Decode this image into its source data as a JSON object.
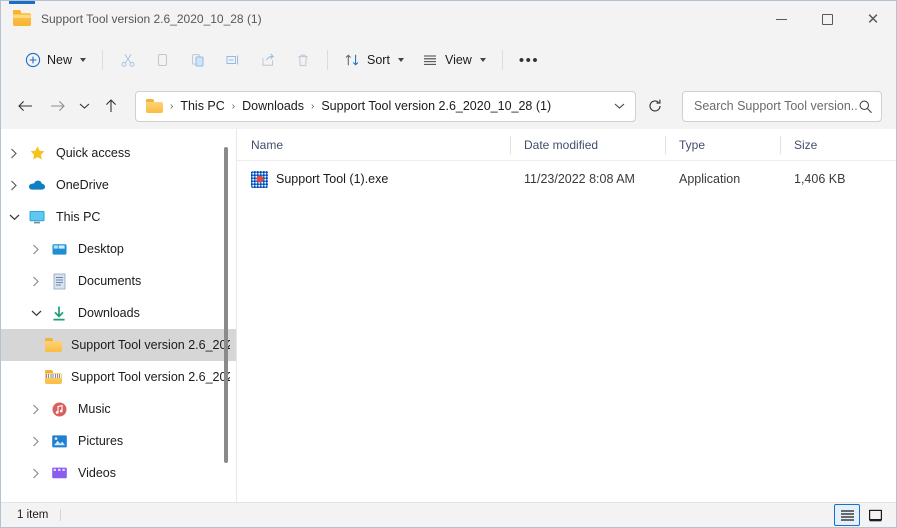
{
  "window": {
    "title": "Support Tool version 2.6_2020_10_28 (1)",
    "folder_icon": "folder-icon",
    "controls": {
      "minimize": "—",
      "maximize": "□",
      "close": "✕"
    }
  },
  "toolbar": {
    "new_label": "New",
    "new_icon": "plus-circle-icon",
    "cut_icon": "scissors-icon",
    "copy_icon": "copy-icon",
    "paste_icon": "clipboard-icon",
    "rename_icon": "rename-icon",
    "share_icon": "share-icon",
    "delete_icon": "trash-icon",
    "sort_label": "Sort",
    "sort_icon": "sort-arrows-icon",
    "view_label": "View",
    "view_icon": "list-lines-icon",
    "more_label": "•••",
    "more_icon": "more-ellipsis-icon"
  },
  "address": {
    "back_icon": "arrow-left-icon",
    "forward_icon": "arrow-right-icon",
    "recent_icon": "chevron-down-icon",
    "up_icon": "arrow-up-icon",
    "crumbs": [
      "This PC",
      "Downloads",
      "Support Tool version 2.6_2020_10_28 (1)"
    ],
    "separator": "›",
    "dropdown_icon": "chevron-down-icon",
    "refresh_icon": "refresh-icon"
  },
  "search": {
    "placeholder": "Search Support Tool version...",
    "icon": "search-icon",
    "value": ""
  },
  "sidebar": {
    "items": [
      {
        "label": "Quick access",
        "icon": "star-icon",
        "indent": 1,
        "expander": "collapsed",
        "selected": false
      },
      {
        "label": "OneDrive",
        "icon": "cloud-icon",
        "indent": 1,
        "expander": "collapsed",
        "selected": false
      },
      {
        "label": "This PC",
        "icon": "monitor-icon",
        "indent": 1,
        "expander": "expanded",
        "selected": false
      },
      {
        "label": "Desktop",
        "icon": "desktop-icon",
        "indent": 2,
        "expander": "collapsed",
        "selected": false
      },
      {
        "label": "Documents",
        "icon": "document-icon",
        "indent": 2,
        "expander": "collapsed",
        "selected": false
      },
      {
        "label": "Downloads",
        "icon": "download-arrow-icon",
        "indent": 2,
        "expander": "expanded",
        "selected": false
      },
      {
        "label": "Support Tool version 2.6_202",
        "icon": "folder-icon",
        "indent": 3,
        "expander": "none",
        "selected": true
      },
      {
        "label": "Support Tool version 2.6_202",
        "icon": "zipped-folder-icon",
        "indent": 3,
        "expander": "none",
        "selected": false
      },
      {
        "label": "Music",
        "icon": "music-note-icon",
        "indent": 2,
        "expander": "collapsed",
        "selected": false
      },
      {
        "label": "Pictures",
        "icon": "picture-icon",
        "indent": 2,
        "expander": "collapsed",
        "selected": false
      },
      {
        "label": "Videos",
        "icon": "video-icon",
        "indent": 2,
        "expander": "collapsed",
        "selected": false
      }
    ]
  },
  "filelist": {
    "columns": [
      "Name",
      "Date modified",
      "Type",
      "Size"
    ],
    "sort_column": "Name",
    "sort_direction": "ascending",
    "rows": [
      {
        "name": "Support Tool (1).exe",
        "icon": "application-exe-icon",
        "date_modified": "11/23/2022 8:08 AM",
        "type": "Application",
        "size": "1,406 KB"
      }
    ]
  },
  "statusbar": {
    "item_count": "1 item",
    "view_details_icon": "details-view-icon",
    "view_large_icons_icon": "large-icons-view-icon",
    "active_view": "details"
  },
  "colors": {
    "accent": "#1a6fc4",
    "window_bg": "#f3f3f3",
    "selection": "#d6d6d6",
    "folder_yellow": "#f7b32b"
  }
}
